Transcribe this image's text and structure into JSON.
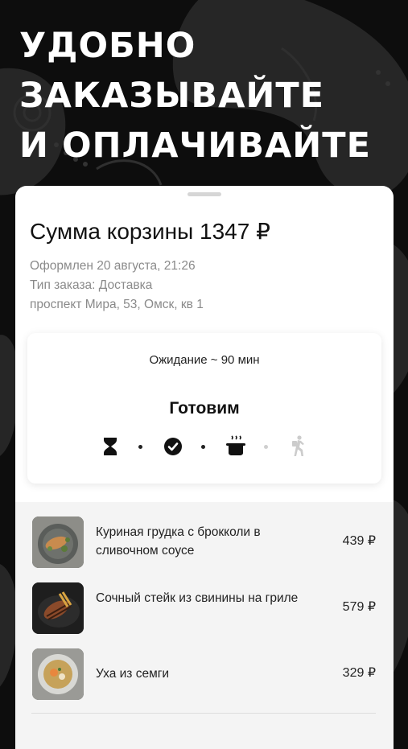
{
  "promo": {
    "headline": [
      "УДОБНО",
      "ЗАКАЗЫВАЙТЕ",
      "И ОПЛАЧИВАЙТЕ"
    ]
  },
  "order": {
    "total_label": "Сумма корзины 1347 ₽",
    "placed": "Оформлен 20 августа, 21:26",
    "type": "Тип заказа: Доставка",
    "address": "проспект Мира, 53, Омск, кв 1"
  },
  "status": {
    "wait_text": "Ожидание ~ 90 мин",
    "stage": "Готовим",
    "steps": [
      {
        "icon": "hourglass-icon",
        "state": "done"
      },
      {
        "icon": "check-circle-icon",
        "state": "done"
      },
      {
        "icon": "cooking-pot-icon",
        "state": "active"
      },
      {
        "icon": "courier-walking-icon",
        "state": "pending"
      }
    ]
  },
  "items": [
    {
      "name": "Куриная грудка с брокколи в сливочном соусе",
      "price": "439 ₽",
      "image": "chicken-breast-photo"
    },
    {
      "name": "Сочный стейк из свинины на гриле",
      "price": "579 ₽",
      "image": "pork-steak-photo"
    },
    {
      "name": "Уха из семги",
      "price": "329 ₽",
      "image": "salmon-soup-photo"
    }
  ],
  "colors": {
    "background": "#0d0d0d",
    "sheet": "#ffffff",
    "muted_text": "#8a8a8a",
    "items_background": "#f4f4f4"
  }
}
